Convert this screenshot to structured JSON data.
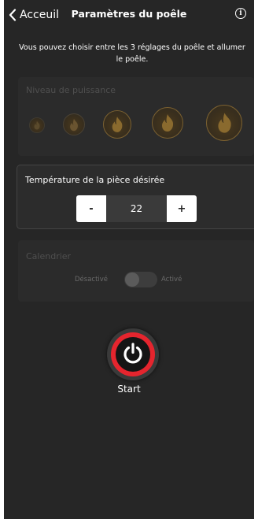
{
  "header": {
    "back_label": "Acceuil",
    "title": "Paramètres du poêle"
  },
  "intro_text": "Vous pouvez choisir entre les 3 réglages du poêle et allumer le poêle.",
  "power": {
    "title": "Niveau de puissance",
    "levels": 5,
    "icon": "flame-icon"
  },
  "temperature": {
    "title": "Température de la pièce désirée",
    "minus_label": "-",
    "value": "22",
    "plus_label": "+"
  },
  "calendar": {
    "title": "Calendrier",
    "off_label": "Désactivé",
    "on_label": "Activé",
    "enabled": false
  },
  "start": {
    "label": "Start",
    "icon": "power-icon"
  },
  "colors": {
    "background": "#262626",
    "card": "#2c2c2c",
    "accent_red": "#e5252e",
    "flame_gold": "#8a6a2e"
  }
}
